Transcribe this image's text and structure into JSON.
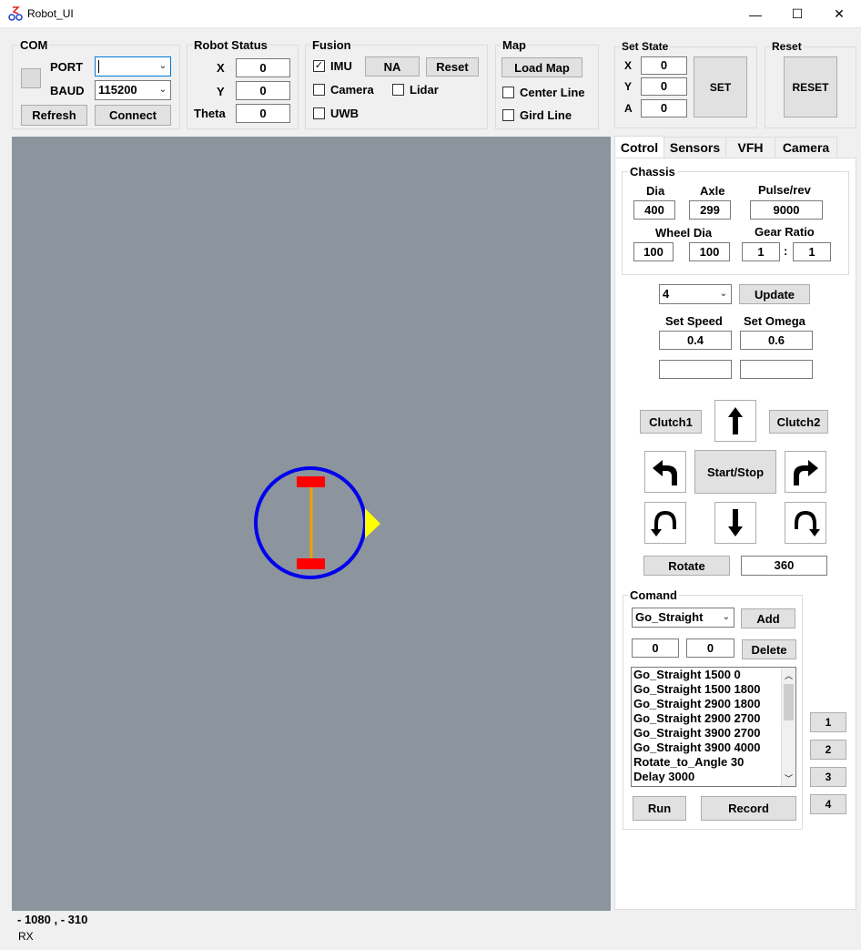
{
  "window": {
    "title": "Robot_UI",
    "minimize": "—",
    "maximize": "☐",
    "close": "✕"
  },
  "com": {
    "group": "COM",
    "port_label": "PORT",
    "port_value": "",
    "baud_label": "BAUD",
    "baud_value": "115200",
    "refresh": "Refresh",
    "connect": "Connect"
  },
  "robot_status": {
    "group": "Robot Status",
    "x_label": "X",
    "x": "0",
    "y_label": "Y",
    "y": "0",
    "theta_label": "Theta",
    "theta": "0"
  },
  "fusion": {
    "group": "Fusion",
    "imu": "IMU",
    "imu_checked": "✓",
    "na": "NA",
    "reset": "Reset",
    "camera": "Camera",
    "lidar": "Lidar",
    "uwb": "UWB"
  },
  "map": {
    "group": "Map",
    "load_map": "Load Map",
    "center_line": "Center Line",
    "grid_line": "Gird Line"
  },
  "set_state": {
    "group": "Set State",
    "x_label": "X",
    "x": "0",
    "y_label": "Y",
    "y": "0",
    "a_label": "A",
    "a": "0",
    "set": "SET"
  },
  "reset_group": {
    "group": "Reset",
    "reset": "RESET"
  },
  "tabs": [
    "Cotrol",
    "Sensors",
    "VFH",
    "Camera"
  ],
  "chassis": {
    "group": "Chassis",
    "dia_label": "Dia",
    "dia": "400",
    "axle_label": "Axle",
    "axle": "299",
    "pulse_label": "Pulse/rev",
    "pulse": "9000",
    "wheel_dia_label": "Wheel Dia",
    "wheel_dia_1": "100",
    "wheel_dia_2": "100",
    "gear_label": "Gear Ratio",
    "gear_1": "1",
    "gear_sep": ":",
    "gear_2": "1"
  },
  "control": {
    "combo": "4",
    "update": "Update",
    "speed_label": "Set Speed",
    "speed": "0.4",
    "omega_label": "Set Omega",
    "omega": "0.6",
    "speed_out": "",
    "omega_out": "",
    "clutch1": "Clutch1",
    "clutch2": "Clutch2",
    "start_stop": "Start/Stop",
    "rotate": "Rotate",
    "rotate_value": "360"
  },
  "command": {
    "group": "Comand",
    "combo": "Go_Straight",
    "add": "Add",
    "p1": "0",
    "p2": "0",
    "delete": "Delete",
    "items": [
      "Go_Straight 1500 0",
      "Go_Straight 1500 1800",
      "Go_Straight 2900 1800",
      "Go_Straight 2900 2700",
      "Go_Straight 3900 2700",
      "Go_Straight 3900 4000",
      "Rotate_to_Angle 30",
      "Delay 3000"
    ],
    "run": "Run",
    "record": "Record"
  },
  "side_buttons": [
    "1",
    "2",
    "3",
    "4"
  ],
  "status": {
    "coords": "- 1080 , - 310",
    "rx": "RX"
  },
  "colors": {
    "canvas": "#8c959d",
    "robot_ring": "#0000ee",
    "wheel": "#ff0000",
    "axle": "#f0a000",
    "heading": "#ffff00"
  }
}
